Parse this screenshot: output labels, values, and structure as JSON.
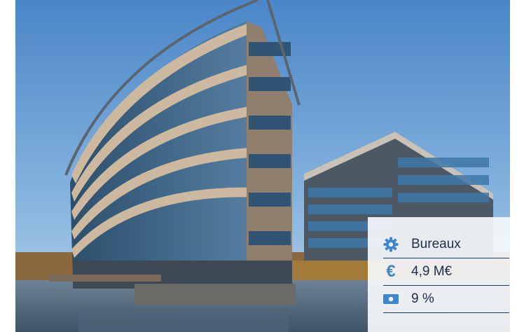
{
  "property_card": {
    "items": [
      {
        "icon": "gear-icon",
        "label": "Bureaux"
      },
      {
        "icon": "euro-icon",
        "label": "4,9 M€",
        "symbol": "€"
      },
      {
        "icon": "banknote-icon",
        "label": "9 %"
      }
    ]
  },
  "colors": {
    "accent": "#3f86cf",
    "text": "#1d2e4f",
    "divider": "#1f3d6b"
  }
}
